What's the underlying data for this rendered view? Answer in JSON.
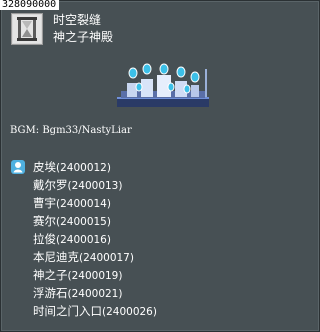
{
  "map_id": "328090000",
  "street_name": "时空裂缝",
  "map_name": "神之子神殿",
  "bgm_label": "BGM:",
  "bgm_value": "Bgm33/NastyLiar",
  "colors": {
    "tooltip_background": "#475054",
    "text": "#ffffff",
    "indicator": "#4fb0e0"
  },
  "icons": {
    "map_icon": "hourglass-icon",
    "npc_indicator": "npc-marker-icon"
  },
  "npcs": [
    {
      "name": "皮埃",
      "id": "(2400012)"
    },
    {
      "name": "戴尔罗",
      "id": "(2400013)"
    },
    {
      "name": "曹宇",
      "id": "(2400014)"
    },
    {
      "name": "赛尔",
      "id": "(2400015)"
    },
    {
      "name": "拉俊",
      "id": "(2400016)"
    },
    {
      "name": "本尼迪克",
      "id": "(2400017)"
    },
    {
      "name": "神之子",
      "id": "(2400019)"
    },
    {
      "name": "浮游石",
      "id": "(2400021)"
    },
    {
      "name": "时间之门入口",
      "id": "(2400026)"
    }
  ]
}
